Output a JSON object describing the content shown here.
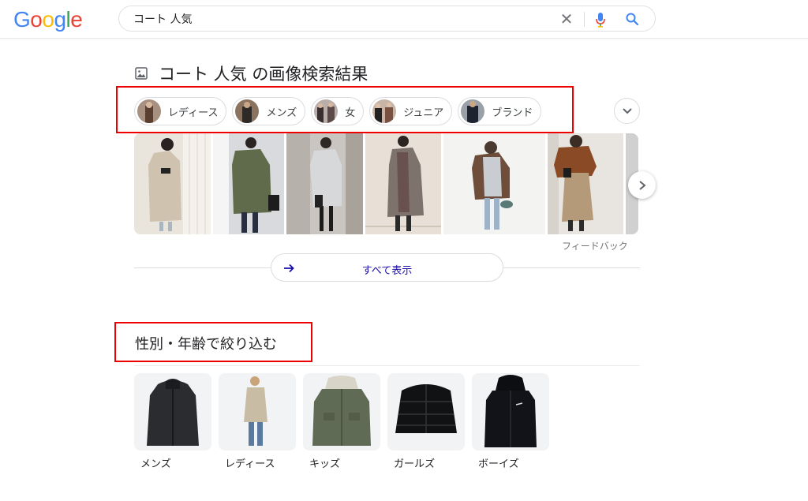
{
  "header": {
    "logo_letters": [
      {
        "ch": "G",
        "color": "#4285f4"
      },
      {
        "ch": "o",
        "color": "#ea4335"
      },
      {
        "ch": "o",
        "color": "#fbbc05"
      },
      {
        "ch": "g",
        "color": "#4285f4"
      },
      {
        "ch": "l",
        "color": "#34a853"
      },
      {
        "ch": "e",
        "color": "#ea4335"
      }
    ],
    "search_query": "コート 人気",
    "clear_icon": "close-icon",
    "mic_icon": "mic-icon",
    "search_icon": "search-icon"
  },
  "images_section": {
    "title": "コート 人気 の画像検索結果",
    "chips": [
      {
        "label": "レディース"
      },
      {
        "label": "メンズ"
      },
      {
        "label": "女"
      },
      {
        "label": "ジュニア"
      },
      {
        "label": "ブランド"
      }
    ],
    "feedback": "フィードバック",
    "show_all": "すべて表示"
  },
  "filter_section": {
    "title": "性別・年齢で絞り込む",
    "items": [
      {
        "label": "メンズ"
      },
      {
        "label": "レディース"
      },
      {
        "label": "キッズ"
      },
      {
        "label": "ガールズ"
      },
      {
        "label": "ボーイズ"
      }
    ]
  },
  "colors": {
    "highlight": "#e00000",
    "link": "#1a0dab",
    "accent_blue": "#4285f4"
  }
}
